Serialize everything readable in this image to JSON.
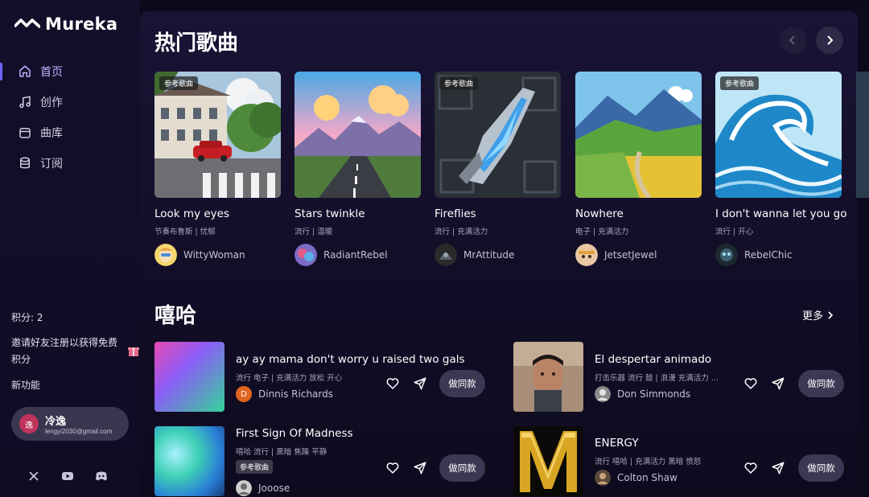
{
  "app": {
    "name": "Mureka"
  },
  "sidebar": {
    "items": [
      {
        "label": "首页",
        "icon": "home-icon",
        "active": true
      },
      {
        "label": "创作",
        "icon": "music-note-icon",
        "active": false
      },
      {
        "label": "曲库",
        "icon": "library-icon",
        "active": false
      },
      {
        "label": "订阅",
        "icon": "database-icon",
        "active": false
      }
    ],
    "points": "积分: 2",
    "invite": "邀请好友注册以获得免费积分",
    "new_features": "新功能",
    "user": {
      "avatar_text": "逸",
      "name": "冷逸",
      "email": "lengyi2030@gmail.com"
    },
    "socials": [
      "x-icon",
      "youtube-icon",
      "discord-icon"
    ]
  },
  "hot": {
    "title": "热门歌曲",
    "ref_tag": "参考歌曲",
    "cards": [
      {
        "title": "Look my eyes",
        "tags": "节奏布鲁斯 | 忧郁",
        "author": "WittyWoman",
        "ref": true
      },
      {
        "title": "Stars twinkle",
        "tags": "流行 | 温暖",
        "author": "RadiantRebel",
        "ref": false
      },
      {
        "title": "Fireflies",
        "tags": "流行 | 充满活力",
        "author": "MrAttitude",
        "ref": true
      },
      {
        "title": "Nowhere",
        "tags": "电子 | 充满活力",
        "author": "JetsetJewel",
        "ref": false
      },
      {
        "title": "I don't wanna let you go",
        "tags": "流行 | 开心",
        "author": "RebelChic",
        "ref": true
      }
    ]
  },
  "hiphop": {
    "title": "嘻哈",
    "more": "更多",
    "same_label": "做同款",
    "ref_tag": "参考歌曲",
    "rows": [
      {
        "title": "ay ay mama don't worry u raised two gals",
        "tags": "流行 电子 | 充满活力 放松 开心",
        "author": "Dinnis Richards",
        "author_initial": "D"
      },
      {
        "title": "El despertar animado",
        "tags": "打击乐器 流行 鼓 | 浪漫 充满活力 ...",
        "author": "Don Simmonds"
      },
      {
        "title": "First Sign Of Madness",
        "tags": "嘻哈 流行 | 黑暗 焦躁 平静",
        "author": "Jooose",
        "ref": true
      },
      {
        "title": "ENERGY",
        "tags": "流行 嘻哈 | 充满活力 黑暗 愤怒",
        "author": "Colton Shaw"
      }
    ]
  },
  "colors": {
    "accent": "#6d63ff",
    "bg": "#0d0a1d",
    "panel": "#1a1335"
  }
}
